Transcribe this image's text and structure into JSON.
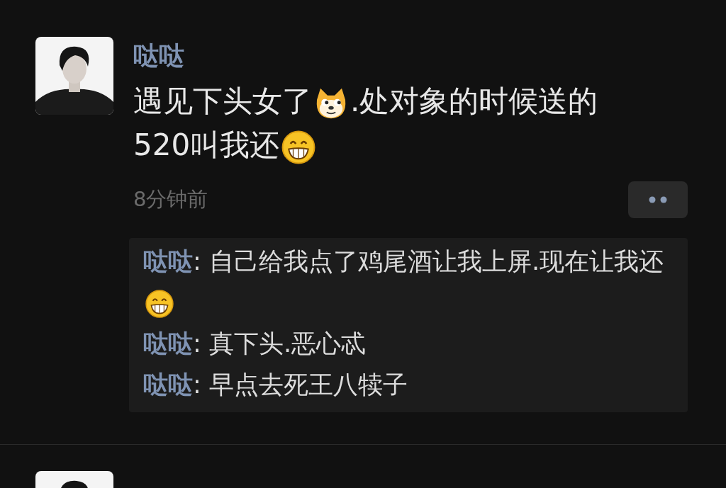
{
  "posts": [
    {
      "kind": "post",
      "author": "哒哒",
      "lines": [
        [
          {
            "kind": "text",
            "text": "遇见下头女了"
          },
          {
            "kind": "doge"
          },
          {
            "kind": "text",
            "text": ".处对象的时候送的"
          }
        ],
        [
          {
            "kind": "text",
            "text": "520叫我还"
          },
          {
            "kind": "grin"
          }
        ]
      ],
      "time": "8分钟前",
      "comments": [
        {
          "author": "哒哒",
          "separator": ":",
          "content": [
            {
              "kind": "text",
              "text": "自己给我点了鸡尾酒让我上屏.现在让我还"
            },
            {
              "kind": "grin"
            }
          ]
        },
        {
          "author": "哒哒",
          "separator": ":",
          "content": [
            {
              "kind": "text",
              "text": "真下头.恶心忒"
            }
          ]
        },
        {
          "author": "哒哒",
          "separator": ":",
          "content": [
            {
              "kind": "text",
              "text": "早点去死王八犊子"
            }
          ]
        }
      ]
    },
    {
      "kind": "cut_off"
    }
  ]
}
